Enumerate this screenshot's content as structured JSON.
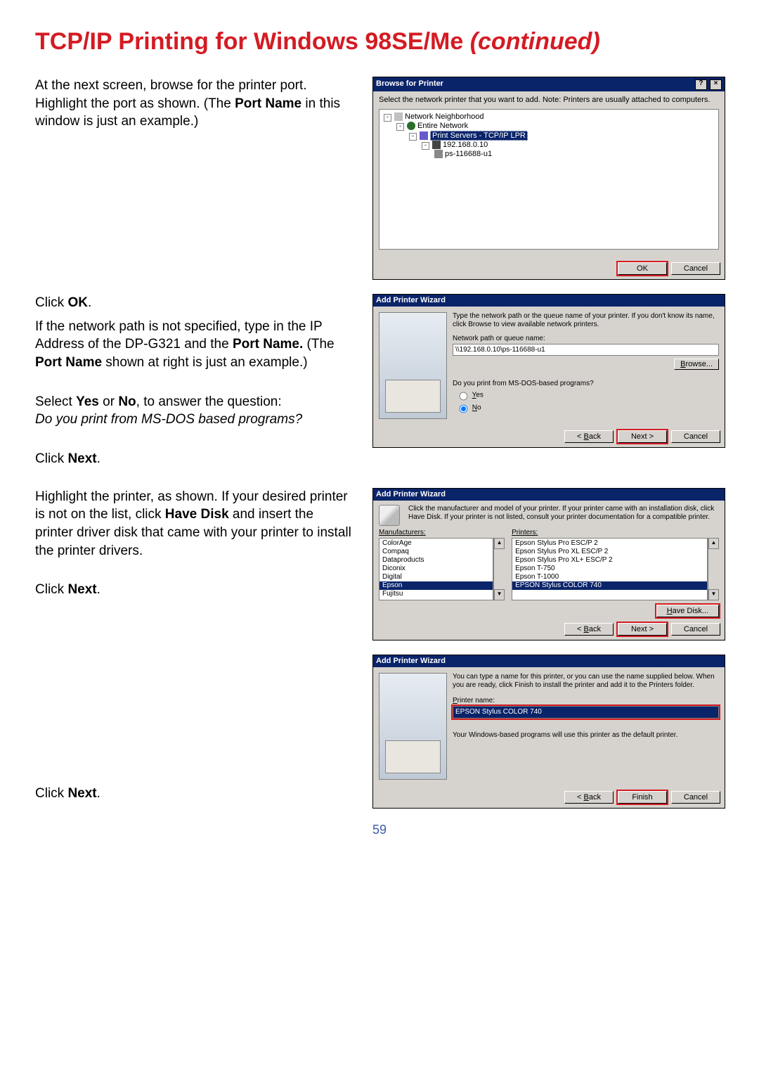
{
  "heading": {
    "main": "TCP/IP Printing for Windows 98SE/Me",
    "cont": "(continued)"
  },
  "page_number": "59",
  "left": {
    "p1a": "At the next screen, browse for the printer port. Highlight the port as shown. (The ",
    "p1b_bold": "Port Name",
    "p1c": " in this window is just an example.)",
    "click_ok_a": "Click ",
    "click_ok_b": "OK",
    "click_ok_c": ".",
    "p2a": "If the network path is not specified, type in the IP Address of the DP-G321 and the ",
    "p2b_bold": "Port Name.",
    "p2c": " (The ",
    "p2d_bold": "Port Name",
    "p2e": " shown at right is just an example.)",
    "p3a": "Select ",
    "p3b_bold": "Yes",
    "p3c": " or ",
    "p3d_bold": "No",
    "p3e": ", to answer the question:",
    "p3f_ital": "Do you print from MS-DOS based programs?",
    "click_next_a": "Click  ",
    "click_next_b": "Next",
    "click_next_c": ".",
    "p4a": "Highlight the printer, as shown. If your desired printer is not on the list, click ",
    "p4b_bold": "Have Disk",
    "p4c": " and insert the printer driver disk that came with your printer to install the printer drivers."
  },
  "browse_dlg": {
    "title": "Browse for Printer",
    "help_glyph": "?",
    "close_glyph": "×",
    "instr": "Select the network printer that you want to add. Note: Printers are usually attached to computers.",
    "nodes": {
      "n0": "Network Neighborhood",
      "n1": "Entire Network",
      "n2": "Print Servers - TCP/IP LPR",
      "n3": "192.168.0.10",
      "n4": "ps-116688-u1"
    },
    "ok": "OK",
    "cancel": "Cancel"
  },
  "wiz1": {
    "title": "Add Printer Wizard",
    "instr": "Type the network path or the queue name of your printer. If you don't know its name, click Browse to view available network printers.",
    "path_label": "Network path or queue name:",
    "path_value": "\\\\192.168.0.10\\ps-116688-u1",
    "browse": "Browse...",
    "q": "Do you print from MS-DOS-based programs?",
    "yes": "Yes",
    "no": "No",
    "back": "< Back",
    "next": "Next >",
    "cancel": "Cancel"
  },
  "wiz2": {
    "title": "Add Printer Wizard",
    "instr": "Click the manufacturer and model of your printer. If your printer came with an installation disk, click Have Disk. If your printer is not listed, consult your printer documentation for a compatible printer.",
    "man_label": "Manufacturers:",
    "prn_label": "Printers:",
    "manufacturers": [
      "ColorAge",
      "Compaq",
      "Dataproducts",
      "Diconix",
      "Digital",
      "Epson",
      "Fujitsu"
    ],
    "man_sel_index": 5,
    "printers": [
      "Epson Stylus Pro ESC/P 2",
      "Epson Stylus Pro XL ESC/P 2",
      "Epson Stylus Pro XL+ ESC/P 2",
      "Epson T-750",
      "Epson T-1000",
      "EPSON Stylus COLOR 740"
    ],
    "prn_sel_index": 5,
    "have_disk": "Have Disk...",
    "back": "< Back",
    "next": "Next >",
    "cancel": "Cancel",
    "scroll_up": "▲",
    "scroll_dn": "▼"
  },
  "wiz3": {
    "title": "Add Printer Wizard",
    "instr": "You can type a name for this printer, or you can use the name supplied below. When you are ready, click Finish to install the printer and add it to the Printers folder.",
    "name_label": "Printer name:",
    "name_value": "EPSON Stylus COLOR 740",
    "note": "Your Windows-based programs will use this printer as the default printer.",
    "back": "< Back",
    "finish": "Finish",
    "cancel": "Cancel"
  }
}
